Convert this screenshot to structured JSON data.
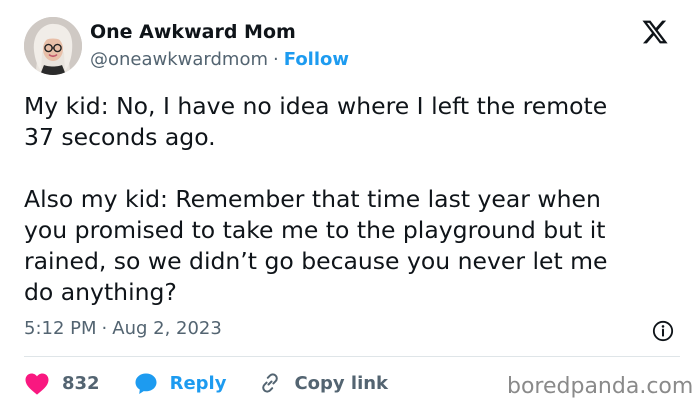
{
  "author": {
    "name": "One Awkward Mom",
    "handle": "@oneawkwardmom",
    "separator": "·",
    "follow_label": "Follow"
  },
  "tweet": {
    "lines_1": [
      "My kid: No, I have no idea where I left the remote",
      "37 seconds ago."
    ],
    "lines_2": [
      "Also my kid: Remember that time last year when",
      "you promised to take me to the playground but it",
      "rained, so we didn’t go because you never let me",
      "do anything?"
    ]
  },
  "meta": {
    "time": "5:12 PM",
    "separator": "·",
    "date": "Aug 2, 2023"
  },
  "actions": {
    "like_count": "832",
    "reply_label": "Reply",
    "copy_link_label": "Copy link"
  },
  "watermark": "boredpanda.com",
  "colors": {
    "text": "#0f1419",
    "secondary": "#536471",
    "accent_blue": "#1d9bf0",
    "heart": "#f91880",
    "divider": "#dfe5e8"
  },
  "icons": {
    "brand": "x-logo-icon",
    "info": "info-icon",
    "like": "heart-icon",
    "reply": "speech-bubble-icon",
    "copy": "link-icon"
  }
}
